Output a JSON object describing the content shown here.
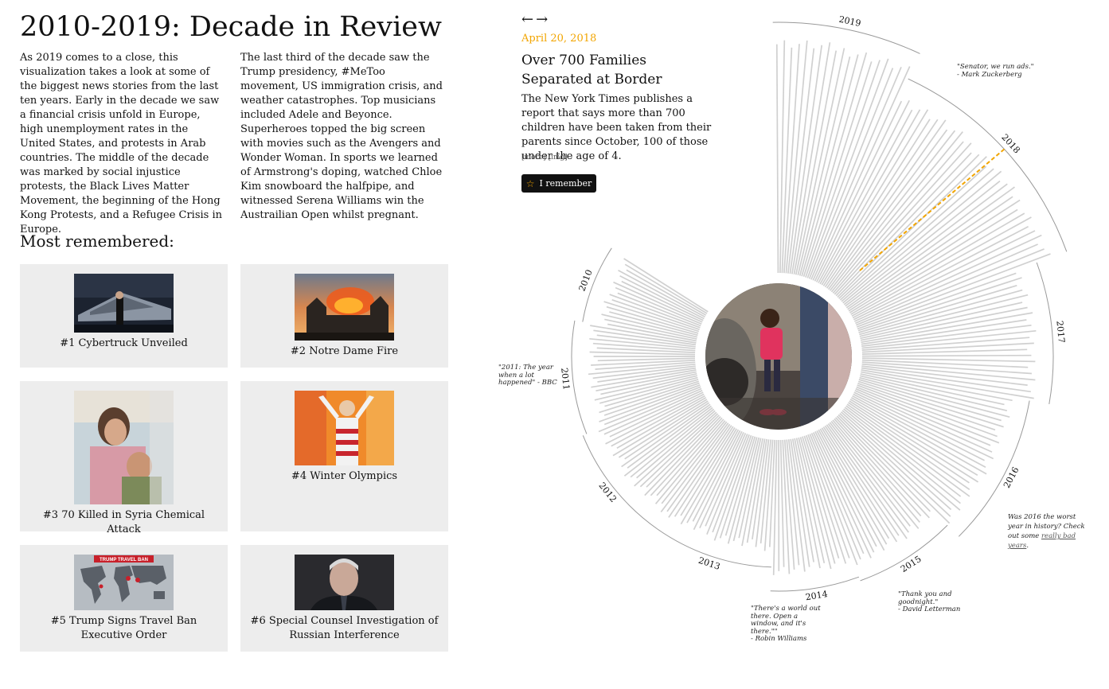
{
  "page": {
    "title": "2010-2019: Decade in Review",
    "intro_col1": "As 2019 comes to a close, this visualization takes a look at some of the biggest news stories from the last ten years. Early in the decade we saw a financial crisis unfold in Europe, high unemployment rates in the United States, and protests in Arab countries. The middle of the decade was marked by social injustice protests, the Black Lives Matter Movement, the beginning of the Hong Kong Protests, and a Refugee Crisis in Europe.",
    "intro_col2": "The last third of the decade saw the Trump presidency, #MeToo movement, US immigration crisis, and weather catastrophes. Top musicians included Adele and Beyonce. Superheroes topped the big screen with movies such as the Avengers and Wonder Woman. In sports we learned of Armstrong's doping, watched Chloe Kim snowboard the halfpipe, and witnessed Serena Williams win the Austrailian Open whilst pregnant.",
    "most_remembered_heading": "Most remembered:"
  },
  "most_remembered": [
    {
      "caption": "#1 Cybertruck Unveiled",
      "image": "cybertruck-photo"
    },
    {
      "caption": "#2 Notre Dame Fire",
      "image": "notre-dame-fire-photo"
    },
    {
      "caption": "#3 70 Killed in Syria Chemical Attack",
      "image": "syria-children-photo"
    },
    {
      "caption": "#4 Winter Olympics",
      "image": "winter-olympics-photo"
    },
    {
      "caption": "#5 Trump Signs Travel Ban Executive Order",
      "image": "travel-ban-map-photo",
      "image_text": "TRUMP TRAVEL BAN"
    },
    {
      "caption": "#6 Special Counsel Investigation of Russian Interference",
      "image": "mueller-portrait-photo"
    }
  ],
  "story": {
    "prev_arrow": "←",
    "next_arrow": "→",
    "date": "April 20, 2018",
    "title": "Over 700 Families Separated at Border",
    "body": "The New York Times publishes a report that says more than 700 children have been taken from their parents since October, 100 of those under the age of 4.",
    "more_link": "[more]",
    "img_link": "[img]",
    "remember_label": "I remember",
    "remember_icon": "star-icon"
  },
  "timeline": {
    "years": [
      "2010",
      "2011",
      "2012",
      "2013",
      "2014",
      "2015",
      "2016",
      "2017",
      "2018",
      "2019"
    ],
    "selected_year": "2018",
    "center_image": "border-child-photo"
  },
  "quotes": {
    "q2011": "\"2011: The year when a lot happened\" - BBC",
    "q2018_line1": "\"Senator, we run ads.\"",
    "q2018_line2": "- Mark Zuckerberg",
    "q2016_prefix": "Was 2016 the worst year in history? Check out some ",
    "q2016_link": "really bad years",
    "q2016_suffix": ".",
    "q2015_line1": "\"Thank you and goodnight.\"",
    "q2015_line2": "- David Letterman",
    "q2014_line1": "\"There's a world out there. Open a window, and it's there.\"\"",
    "q2014_line2": "- Robin Williams"
  },
  "colors": {
    "accent": "#f2a500",
    "bar": "#d0d0d0",
    "card_bg": "#ededed",
    "button_bg": "#111111"
  }
}
